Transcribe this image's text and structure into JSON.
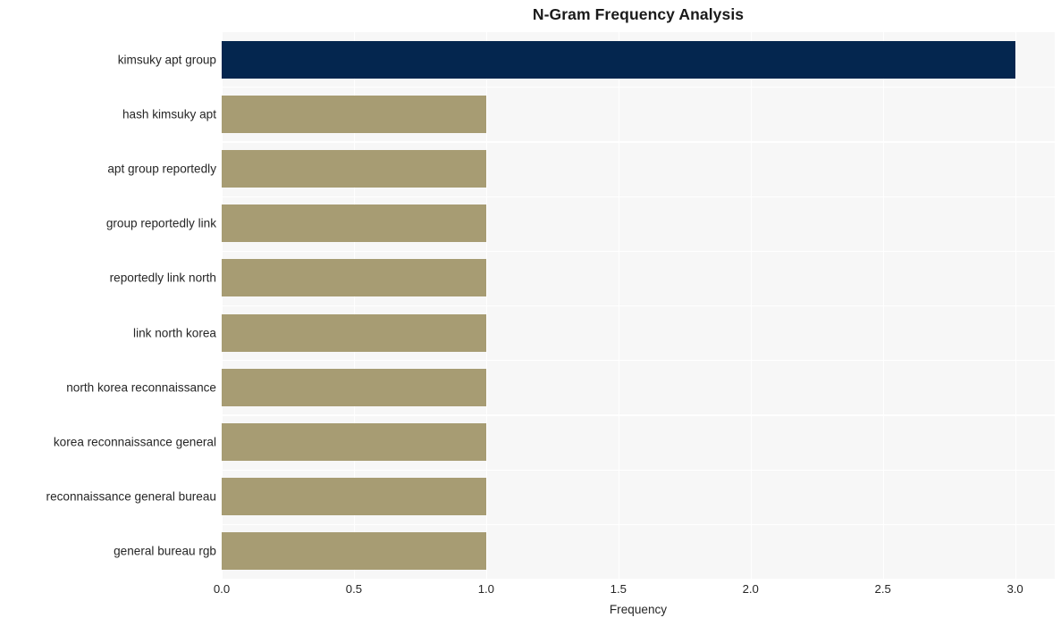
{
  "chart_data": {
    "type": "bar",
    "orientation": "horizontal",
    "title": "N-Gram Frequency Analysis",
    "xlabel": "Frequency",
    "ylabel": "",
    "xlim": [
      0.0,
      3.15
    ],
    "xticks": [
      "0.0",
      "0.5",
      "1.0",
      "1.5",
      "2.0",
      "2.5",
      "3.0"
    ],
    "xtick_values": [
      0.0,
      0.5,
      1.0,
      1.5,
      2.0,
      2.5,
      3.0
    ],
    "grid": true,
    "legend": false,
    "categories": [
      "kimsuky apt group",
      "hash kimsuky apt",
      "apt group reportedly",
      "group reportedly link",
      "reportedly link north",
      "link north korea",
      "north korea reconnaissance",
      "korea reconnaissance general",
      "reconnaissance general bureau",
      "general bureau rgb"
    ],
    "values": [
      3,
      1,
      1,
      1,
      1,
      1,
      1,
      1,
      1,
      1
    ],
    "bar_colors": [
      "#04264f",
      "#a79c73",
      "#a79c73",
      "#a79c73",
      "#a79c73",
      "#a79c73",
      "#a79c73",
      "#a79c73",
      "#a79c73",
      "#a79c73"
    ]
  },
  "style": {
    "plot_background": "#f7f7f7",
    "figure_background": "#ffffff",
    "grid_color": "#ffffff",
    "text_color": "#262626",
    "title_color": "#1a1a1a",
    "highlight_color": "#04264f",
    "bar_color": "#a79c73"
  }
}
